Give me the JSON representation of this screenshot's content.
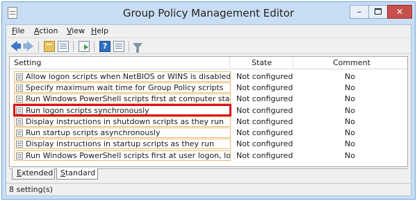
{
  "window": {
    "title": "Group Policy Management Editor"
  },
  "menu": [
    {
      "accel": "F",
      "rest": "ile"
    },
    {
      "accel": "A",
      "rest": "ction"
    },
    {
      "accel": "V",
      "rest": "iew"
    },
    {
      "accel": "H",
      "rest": "elp"
    }
  ],
  "toolbar": {
    "icons": [
      "back-arrow-icon",
      "forward-arrow-icon",
      "up-folder-icon",
      "show-hide-pane-icon",
      "export-list-icon",
      "help-icon",
      "properties-icon",
      "filter-icon"
    ]
  },
  "table": {
    "columns": {
      "setting": "Setting",
      "state": "State",
      "comment": "Comment"
    },
    "rows": [
      {
        "setting": "Allow logon scripts when NetBIOS or WINS is disabled",
        "state": "Not configured",
        "comment": "No"
      },
      {
        "setting": "Specify maximum wait time for Group Policy scripts",
        "state": "Not configured",
        "comment": "No"
      },
      {
        "setting": "Run Windows PowerShell scripts first at computer startup, s...",
        "state": "Not configured",
        "comment": "No"
      },
      {
        "setting": "Run logon scripts synchronously",
        "state": "Not configured",
        "comment": "No"
      },
      {
        "setting": "Display instructions in shutdown scripts as they run",
        "state": "Not configured",
        "comment": "No"
      },
      {
        "setting": "Run startup scripts asynchronously",
        "state": "Not configured",
        "comment": "No"
      },
      {
        "setting": "Display instructions in startup scripts as they run",
        "state": "Not configured",
        "comment": "No"
      },
      {
        "setting": "Run Windows PowerShell scripts first at user logon, logoff",
        "state": "Not configured",
        "comment": "No"
      }
    ]
  },
  "tabs": {
    "extended": {
      "accel": "E",
      "rest": "xtended"
    },
    "standard": {
      "accel": "S",
      "rest": "tandard"
    }
  },
  "status": {
    "text": "8 setting(s)"
  },
  "colors": {
    "highlight": "#d9141c",
    "row_border": "#e9b870",
    "title_bar": "#c9def4"
  }
}
